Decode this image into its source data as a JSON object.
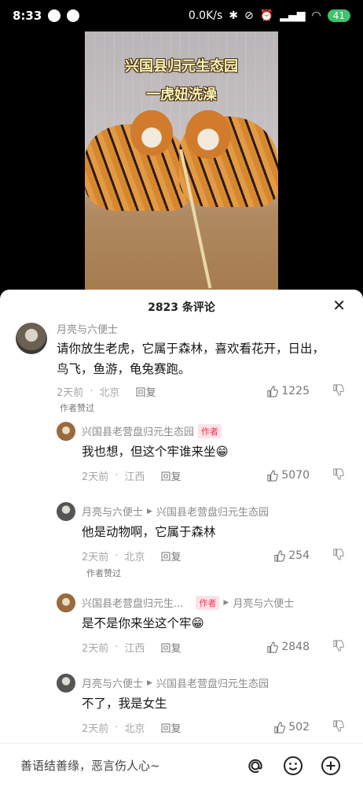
{
  "status_bar": {
    "time": "8:33",
    "net_speed": "0.0K/s",
    "battery": "41"
  },
  "video": {
    "title_line1": "兴国县归元生态园",
    "title_line2": "一虎妞洗澡"
  },
  "comments_panel": {
    "count_label": "2823 条评论",
    "close_icon": "close-icon",
    "comments": [
      {
        "author": "月亮与六便士",
        "text_line1": "请你放生老虎，它属于森林，喜欢看花开，日出，",
        "text_line2": "鸟飞，鱼游，龟兔赛跑。",
        "time": "2天前",
        "location": "北京",
        "reply": "回复",
        "likes": "1225",
        "liked_by_author": "作者赞过"
      },
      {
        "author": "兴国县老营盘归元生态园",
        "author_tag": "作者",
        "text": "我也想，但这个牢谁来坐",
        "emoji": "grin-emoji",
        "time": "2天前",
        "location": "江西",
        "reply": "回复",
        "likes": "5070"
      },
      {
        "author": "月亮与六便士",
        "reply_to": "兴国县老营盘归元生态园",
        "text": "他是动物啊，它属于森林",
        "time": "2天前",
        "location": "北京",
        "reply": "回复",
        "likes": "254",
        "liked_by_author": "作者赞过"
      },
      {
        "author": "兴国县老营盘归元生...",
        "author_tag": "作者",
        "reply_to": "月亮与六便士",
        "text": "是不是你来坐这个牢",
        "emoji": "grin-emoji",
        "time": "2天前",
        "location": "江西",
        "reply": "回复",
        "likes": "2848"
      },
      {
        "author": "月亮与六便士",
        "reply_to": "兴国县老营盘归元生态园",
        "text": "不了，我是女生",
        "time": "2天前",
        "location": "北京",
        "reply": "回复",
        "likes": "502"
      }
    ]
  },
  "input_bar": {
    "placeholder": "善语结善缘，恶言伤人心~",
    "icons": [
      "at-icon",
      "emoji-icon",
      "add-icon"
    ]
  },
  "colors": {
    "author_tag": "#fe2c55",
    "battery": "#3fc36a"
  }
}
